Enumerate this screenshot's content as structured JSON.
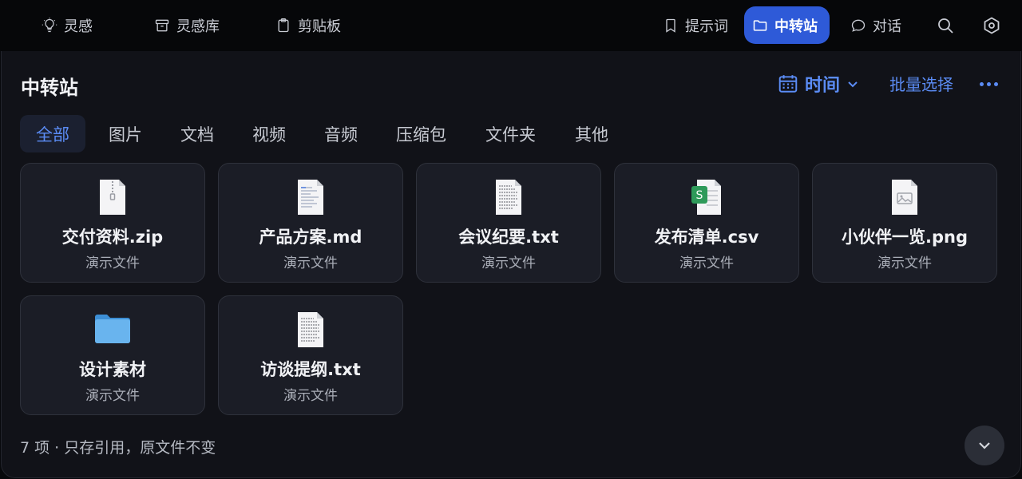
{
  "nav": {
    "left": [
      {
        "label": "灵感",
        "icon": "lightbulb-icon"
      },
      {
        "label": "灵感库",
        "icon": "archive-box-icon"
      },
      {
        "label": "剪贴板",
        "icon": "clipboard-icon"
      }
    ],
    "right": [
      {
        "label": "提示词",
        "icon": "bookmark-icon"
      },
      {
        "label": "中转站",
        "icon": "folder-icon",
        "active": true
      },
      {
        "label": "对话",
        "icon": "chat-bubble-icon"
      }
    ],
    "search_icon": "search-icon",
    "settings_icon": "hexagon-settings-icon"
  },
  "header": {
    "title": "中转站",
    "sort_label": "时间",
    "batch_label": "批量选择"
  },
  "filters": [
    "全部",
    "图片",
    "文档",
    "视频",
    "音频",
    "压缩包",
    "文件夹",
    "其他"
  ],
  "active_filter": 0,
  "files": [
    {
      "name": "交付资料.zip",
      "sub": "演示文件",
      "icon": "zip-file-icon"
    },
    {
      "name": "产品方案.md",
      "sub": "演示文件",
      "icon": "markdown-file-icon"
    },
    {
      "name": "会议纪要.txt",
      "sub": "演示文件",
      "icon": "text-file-icon"
    },
    {
      "name": "发布清单.csv",
      "sub": "演示文件",
      "icon": "spreadsheet-file-icon"
    },
    {
      "name": "小伙伴一览.png",
      "sub": "演示文件",
      "icon": "image-file-icon"
    },
    {
      "name": "设计素材",
      "sub": "演示文件",
      "icon": "folder-icon"
    },
    {
      "name": "访谈提纲.txt",
      "sub": "演示文件",
      "icon": "text-file-icon"
    }
  ],
  "footer_text": "7 项 · 只存引用，原文件不变",
  "colors": {
    "accent": "#5b8cf5",
    "active_nav": "#2e5ad8",
    "background": "#111218",
    "card": "#1b1d26"
  }
}
